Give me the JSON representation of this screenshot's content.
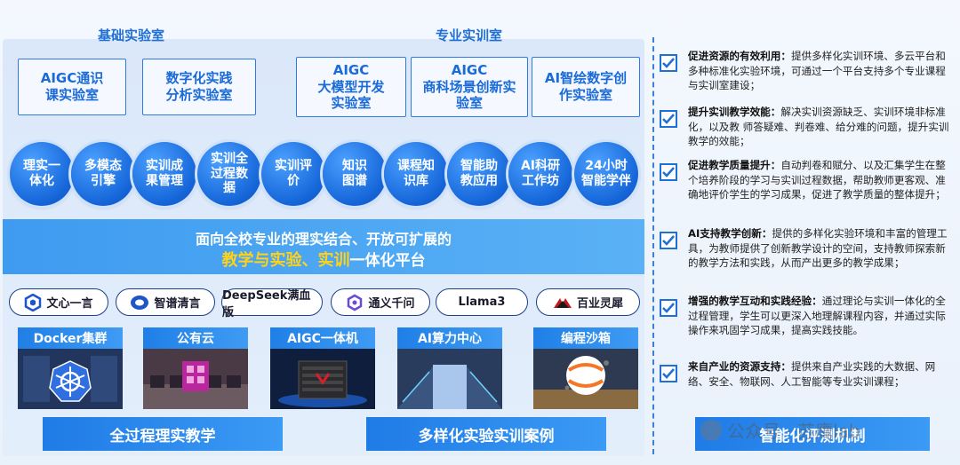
{
  "sections": {
    "basic_lab": "基础实验室",
    "pro_lab": "专业实训室"
  },
  "labs": [
    "AIGC通识\n课实验室",
    "数字化实践\n分析实验室",
    "AIGC\n大模型开发\n实验室",
    "AIGC\n商科场景创新实\n验室",
    "AI智绘数字创\n作实验室"
  ],
  "features": [
    "理实一\n体化",
    "多模态\n引擎",
    "实训成\n果管理",
    "实训全\n过程数\n据",
    "实训评\n价",
    "知识\n图谱",
    "课程知\n识库",
    "智能助\n教应用",
    "AI科研\n工作坊",
    "24小时\n智能学伴"
  ],
  "platform": {
    "line1": "面向全校专业的理实结合、开放可扩展的",
    "line2_highlight": "教学与实验、实训",
    "line2_rest": "一体化平台"
  },
  "models": [
    "文心一言",
    "智谱清言",
    "DeepSeek满血版",
    "通义千问",
    "Llama3",
    "百业灵犀"
  ],
  "infrastructure": [
    "Docker集群",
    "公有云",
    "AIGC一体机",
    "AI算力中心",
    "编程沙箱"
  ],
  "banners": [
    "全过程理实教学",
    "多样化实验实训案例",
    "智能化评测机制"
  ],
  "benefits": [
    {
      "title": "促进资源的有效利用：",
      "text": "提供多样化实训环境、多云平台和多种标准化实验环境，可通过一个平台支持多个专业课程与实训室建设；"
    },
    {
      "title": "提升实训教学效能：",
      "text": "解决实训资源缺乏、实训环境非标准化，以及教 师答疑难、判卷难、给分难的问题，提升实训教学的效能；"
    },
    {
      "title": "促进教学质量提升：",
      "text": "自动判卷和赋分、以及汇集学生在整个培养阶段的学习与实训过程数据，帮助教师更客观、准确地评价学生的学习成果，促进了教学质量的整体提升；"
    },
    {
      "title": "AI支持教学创新：",
      "text": "提供的多样化实验环境和丰富的管理工具，为教师提供了创新教学设计的空间，支持教师探索新的教学方法和实践，从而产出更多的教学成果；"
    },
    {
      "title": "增强的教学互动和实践经验：",
      "text": "通过理论与实训一体化的全过程管理，学生可以更深入地理解课程内容，并通过实际操作来巩固学习成果，提高实践技能。"
    },
    {
      "title": "来自产业的资源支持：",
      "text": "提供来自产业实践的大数据、网络、安全、物联网、人工智能等专业实训课程；"
    }
  ],
  "watermark": "公众号 · 苏鹰lab",
  "colors": {
    "primary": "#1e6fd6",
    "highlight": "#ffd21a",
    "dark": "#1b2d52"
  }
}
